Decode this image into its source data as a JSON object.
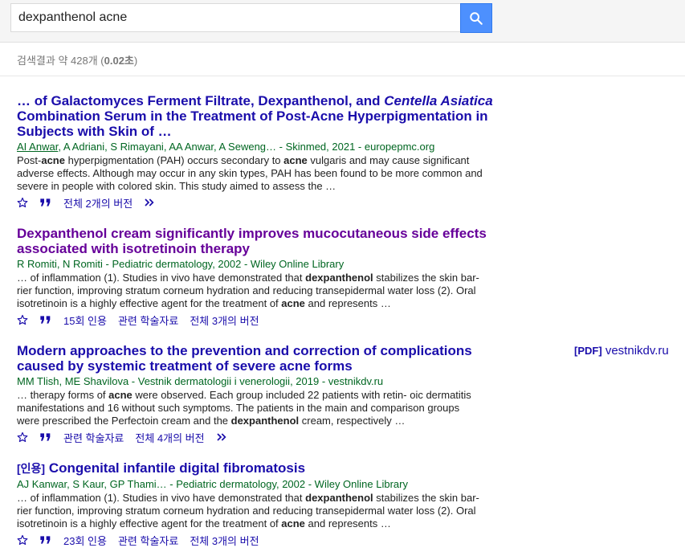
{
  "search": {
    "query": "dexpanthenol acne"
  },
  "stats": {
    "prefix": "검색결과 약 428개 (",
    "time": "0.02초",
    "suffix": ")"
  },
  "results": [
    {
      "title_parts": [
        {
          "t": "… of Galactomyces Ferment Filtrate, ",
          "s": "n"
        },
        {
          "t": "Dexpanthenol",
          "s": "b"
        },
        {
          "t": ", and ",
          "s": "n"
        },
        {
          "t": "Centella Asiatica",
          "s": "i"
        },
        {
          "t": " Combination Serum in the Treatment of Post-",
          "s": "n"
        },
        {
          "t": "Acne",
          "s": "b"
        },
        {
          "t": " Hyperpigmentation in Subjects with Skin of …",
          "s": "n"
        }
      ],
      "authors_first": "AI Anwar",
      "authors_rest": ", A Adriani, S Rimayani, AA Anwar, A Seweng… - Skinmed, 2021 - europepmc.org",
      "snippet_parts": [
        {
          "t": "Post-",
          "s": "n"
        },
        {
          "t": "acne",
          "s": "b"
        },
        {
          "t": " hyperpigmentation (PAH) occurs secondary to ",
          "s": "n"
        },
        {
          "t": "acne",
          "s": "b"
        },
        {
          "t": " vulgaris and may cause significant adverse effects. Although may occur in any skin types, PAH has been found to be more common and severe in people with colored skin. This study aimed to assess the …",
          "s": "n"
        }
      ],
      "actions": [
        "전체 2개의 버전"
      ],
      "more": true
    },
    {
      "title_parts": [
        {
          "t": "Dexpanthenol",
          "s": "b"
        },
        {
          "t": " cream significantly improves mucocutaneous side effects associated with isotretinoin therapy",
          "s": "n"
        }
      ],
      "visited": true,
      "authors_first": "",
      "authors_rest": "R Romiti, N Romiti - Pediatric dermatology, 2002 - Wiley Online Library",
      "snippet_parts": [
        {
          "t": "… of inflammation (1). Studies in vivo have demonstrated that ",
          "s": "n"
        },
        {
          "t": "dexpanthenol",
          "s": "b"
        },
        {
          "t": " stabilizes the skin bar- rier function, improving stratum corneum hydration and reducing transepidermal water loss (2). Oral isotretinoin is a highly effective agent for the treatment of ",
          "s": "n"
        },
        {
          "t": "acne",
          "s": "b"
        },
        {
          "t": " and represents …",
          "s": "n"
        }
      ],
      "actions": [
        "15회 인용",
        "관련 학술자료",
        "전체 3개의 버전"
      ],
      "more": false
    },
    {
      "title_parts": [
        {
          "t": "Modern approaches to the prevention and correction of complications caused by systemic treatment of severe ",
          "s": "n"
        },
        {
          "t": "acne",
          "s": "b"
        },
        {
          "t": " forms",
          "s": "n"
        }
      ],
      "authors_first": "",
      "authors_rest": "MM Tlish, ME Shavilova - Vestnik dermatologii i venerologii, 2019 - vestnikdv.ru",
      "snippet_parts": [
        {
          "t": "… therapy forms of ",
          "s": "n"
        },
        {
          "t": "acne",
          "s": "b"
        },
        {
          "t": " were observed. Each group included 22 patients with retin- oic dermatitis manifestations and 16 without such symptoms. The patients in the main and comparison groups were prescribed the Perfectoin cream and the ",
          "s": "n"
        },
        {
          "t": "dexpanthenol",
          "s": "b"
        },
        {
          "t": " cream, respectively …",
          "s": "n"
        }
      ],
      "actions": [
        "관련 학술자료",
        "전체 4개의 버전"
      ],
      "more": true
    },
    {
      "tag": "[인용]",
      "title_parts": [
        {
          "t": " Congenital infantile digital fibromatosis",
          "s": "n"
        }
      ],
      "authors_first": "",
      "authors_rest": "AJ Kanwar, S Kaur, GP Thami… - Pediatric dermatology, 2002 - Wiley Online Library",
      "snippet_parts": [
        {
          "t": "… of inflammation (1). Studies in vivo have demonstrated that ",
          "s": "n"
        },
        {
          "t": "dexpanthenol",
          "s": "b"
        },
        {
          "t": " stabilizes the skin bar- rier function, improving stratum corneum hydration and reducing transepidermal water loss (2). Oral isotretinoin is a highly effective agent for the treatment of ",
          "s": "n"
        },
        {
          "t": "acne",
          "s": "b"
        },
        {
          "t": " and represents …",
          "s": "n"
        }
      ],
      "actions": [
        "23회 인용",
        "관련 학술자료",
        "전체 3개의 버전"
      ],
      "more": false
    }
  ],
  "side_link": {
    "tag": "[PDF]",
    "label": "vestnikdv.ru"
  }
}
